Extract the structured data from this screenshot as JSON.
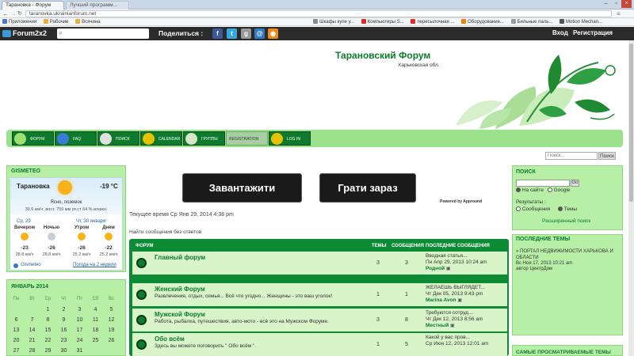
{
  "browser": {
    "tabs": [
      {
        "label": "Тарановка - Форум"
      },
      {
        "label": "Лучший программ..."
      }
    ],
    "url": "taranovka.ukrainianforum.net",
    "bookmarks": [
      "Приложения",
      "Рабочие",
      "Всячина",
      "Шкафы купе у...",
      "Компьютеры S...",
      "пересылочная ...",
      "Оборудование...",
      "Бильные паль...",
      "Motion Mechan..."
    ],
    "bookmark_colors": [
      "#4a78c2",
      "#e7b23b",
      "#e7b23b",
      "#8a8a8a",
      "#d93025",
      "#d93025",
      "#e8840c",
      "#9a9a9a",
      "#555555"
    ]
  },
  "toolbar": {
    "logo": "Forum2x2",
    "share_label": "Поделиться :",
    "login": "Вход",
    "register": "Регистрация"
  },
  "header": {
    "title": "Тарановский Форум",
    "subtitle": "Харьковская обл."
  },
  "nav": {
    "items": [
      {
        "label": "ФОРУМ"
      },
      {
        "label": "FAQ"
      },
      {
        "label": "ПОИСК"
      },
      {
        "label": "CALENDAR"
      },
      {
        "label": "ГРУППЫ"
      },
      {
        "label": "REGISTRATION"
      },
      {
        "label": "LOG IN"
      }
    ]
  },
  "quicksearch": {
    "placeholder": "Поиск...",
    "button": "Поиск"
  },
  "gismeteo": {
    "title": "GISMETEO",
    "city": "Тарановка",
    "temp": "-19 °C",
    "condition": "Ясно, поземок",
    "details": "39.6 км/ч, вост.   759 мм рт.ст   64 % влажн.",
    "day1": "Ср, 29",
    "day2": "Чт, 30 января",
    "periods": [
      "Вечером",
      "Ночью",
      "Утром",
      "Днем"
    ],
    "temps": [
      "-23",
      "-26",
      "-26",
      "-22"
    ],
    "winds": [
      "28.8 км/ч",
      "28.8 км/ч",
      "25.2 км/ч",
      "25.2 км/ч"
    ],
    "brand": "Gismeteo",
    "forecast_link": "Погода на 2 недели"
  },
  "calendar": {
    "title": "ЯНВАРЬ 2014",
    "days": [
      "Пн",
      "Вт",
      "Ср",
      "Чт",
      "Пт",
      "Сб",
      "Вс"
    ],
    "rows": [
      [
        "",
        "",
        "1",
        "2",
        "3",
        "4",
        "5"
      ],
      [
        "6",
        "7",
        "8",
        "9",
        "10",
        "11",
        "12"
      ],
      [
        "13",
        "14",
        "15",
        "16",
        "17",
        "18",
        "19"
      ],
      [
        "20",
        "21",
        "22",
        "23",
        "24",
        "25",
        "26"
      ],
      [
        "27",
        "28",
        "29",
        "30",
        "31",
        "",
        ""
      ]
    ]
  },
  "ad": {
    "download": "Завантажити",
    "play": "Грати зараз",
    "powered": "Powered by Appround"
  },
  "main": {
    "current_time": "Текущее время Ср Янв 29, 2014 4:38 pm",
    "unanswered": "Найти сообщения без ответов",
    "table_header": {
      "forum": "ФОРУМ",
      "topics": "ТЕМЫ",
      "posts": "СООБЩЕНИЯ",
      "last": "ПОСЛЕДНИЕ СООБЩЕНИЯ"
    },
    "forums": [
      {
        "title": "Главный форум",
        "desc": "",
        "topics": "3",
        "posts": "3",
        "last_title": "Вводная статья...",
        "last_date": "Пн Апр 29, 2013 10:24 am",
        "last_author": "Родной"
      },
      {
        "title": "Женский Форум",
        "desc": "Развлечения, отдых, семья... Всё что угодно... Женщины - это ваш уголок!",
        "topics": "1",
        "posts": "1",
        "last_title": "ЖЕЛАЕШЬ ВЫГЛЯДЕТ...",
        "last_date": "Чт Дек 05, 2013 9:43 pm",
        "last_author": "Marina Avon"
      },
      {
        "title": "Мужской Форум",
        "desc": "Работа, рыбалка, путешествия, авто-мото - всё это на Мужском Форуме.",
        "topics": "3",
        "posts": "8",
        "last_title": "Требуются сотруд...",
        "last_date": "Чт Дек 12, 2013 8:56 am",
        "last_author": "Местный"
      },
      {
        "title": "Обо всём",
        "desc": "Здесь вы можете поговорить \" Обо всём \".",
        "topics": "1",
        "posts": "5",
        "last_title": "Какой у вас пров...",
        "last_date": "Ср Июн 12, 2013 12:01 am",
        "last_author": ""
      }
    ]
  },
  "right": {
    "search_title": "ПОИСК",
    "go": "Go",
    "on_site": "На сайте",
    "google": "Google",
    "results_label": "Результаты :",
    "results_posts": "Сообщения",
    "results_topics": "Темы",
    "advanced": "Расширенный поиск",
    "latest_title": "ПОСЛЕДНИЕ ТЕМЫ",
    "latest_item": "» ПОРТАЛ НЕДВИЖИМОСТИ ХАРЬКОВА И ОБЛАСТИ",
    "latest_date": "Вс Ноя 17, 2013 10:21 am",
    "latest_author": "автор ЦентрДом",
    "most_viewed_title": "САМЫЕ ПРОСМАТРИВАЕМЫЕ ТЕМЫ"
  }
}
